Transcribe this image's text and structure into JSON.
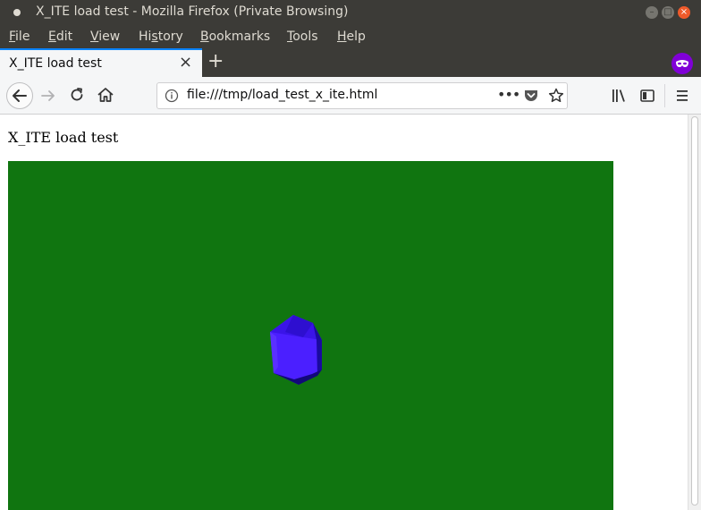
{
  "window": {
    "title": "X_ITE load test - Mozilla Firefox (Private Browsing)"
  },
  "menu": {
    "items": [
      {
        "first": "F",
        "rest": "ile"
      },
      {
        "first": "E",
        "rest": "dit"
      },
      {
        "first": "V",
        "rest": "iew"
      },
      {
        "pre": "Hi",
        "first": "s",
        "rest": "tory"
      },
      {
        "first": "B",
        "rest": "ookmarks"
      },
      {
        "first": "T",
        "rest": "ools"
      },
      {
        "first": "H",
        "rest": "elp"
      }
    ]
  },
  "tabs": [
    {
      "label": "X_ITE load test",
      "active": true
    }
  ],
  "new_tab_label": "+",
  "urlbar": {
    "url": "file:///tmp/load_test_x_ite.html",
    "more_label": "•••"
  },
  "page": {
    "heading": "X_ITE load test",
    "canvas_background": "#107510",
    "shape_color": "#4b1fff"
  },
  "colors": {
    "titlebar": "#3c3b37",
    "tab_accent": "#0a84ff",
    "private_badge": "#8000d7",
    "close_button": "#ef5a2a"
  },
  "icons": [
    "back-icon",
    "forward-icon",
    "reload-icon",
    "home-icon",
    "info-icon",
    "pocket-icon",
    "star-icon",
    "library-icon",
    "sidebar-icon",
    "hamburger-menu-icon",
    "private-browsing-icon"
  ]
}
